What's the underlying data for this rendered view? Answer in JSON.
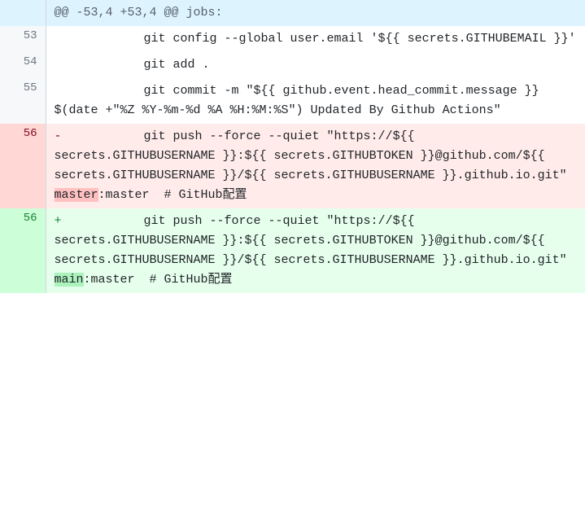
{
  "hunk_header": "@@ -53,4 +53,4 @@ jobs:",
  "lines": {
    "l53": {
      "num": "53",
      "code": "          git config --global user.email '${{ secrets.GITHUBEMAIL }}'"
    },
    "l54": {
      "num": "54",
      "code": "          git add ."
    },
    "l55": {
      "num": "55",
      "code": "          git commit -m \"${{ github.event.head_commit.message }} $(date +\"%Z %Y-%m-%d %A %H:%M:%S\") Updated By Github Actions\""
    },
    "del": {
      "num": "56",
      "prefix": "          git push --force --quiet \"https://${{ secrets.GITHUBUSERNAME }}:${{ secrets.GITHUBTOKEN }}@github.com/${{ secrets.GITHUBUSERNAME }}/${{ secrets.GITHUBUSERNAME }}.github.io.git\" ",
      "changed": "master",
      "suffix": ":master  # GitHub配置"
    },
    "add": {
      "num": "56",
      "prefix": "          git push --force --quiet \"https://${{ secrets.GITHUBUSERNAME }}:${{ secrets.GITHUBTOKEN }}@github.com/${{ secrets.GITHUBUSERNAME }}/${{ secrets.GITHUBUSERNAME }}.github.io.git\" ",
      "changed": "main",
      "suffix": ":master  # GitHub配置"
    }
  },
  "markers": {
    "del": "-",
    "add": "+"
  }
}
